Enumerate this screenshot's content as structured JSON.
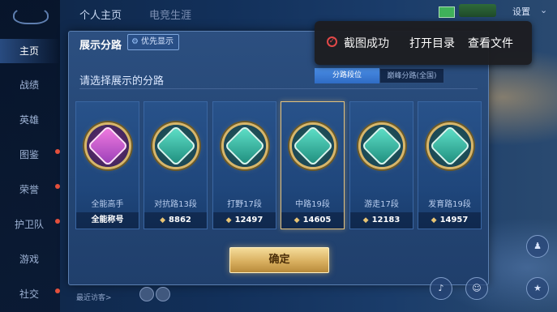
{
  "sidebar": {
    "items": [
      {
        "label": "主页",
        "active": true,
        "badge": false
      },
      {
        "label": "战绩",
        "active": false,
        "badge": false
      },
      {
        "label": "英雄",
        "active": false,
        "badge": false
      },
      {
        "label": "图鉴",
        "active": false,
        "badge": true
      },
      {
        "label": "荣誉",
        "active": false,
        "badge": true
      },
      {
        "label": "护卫队",
        "active": false,
        "badge": true
      },
      {
        "label": "游戏",
        "active": false,
        "badge": false
      },
      {
        "label": "社交",
        "active": false,
        "badge": true
      }
    ]
  },
  "header": {
    "tabs": [
      "个人主页",
      "电竞生涯"
    ],
    "settings_label": "设置"
  },
  "panel": {
    "title": "展示分路",
    "priority_label": "优先显示",
    "subtitle": "请选择展示的分路",
    "segments": [
      "分路段位",
      "巅峰分路(全国)"
    ],
    "confirm_label": "确定"
  },
  "cards": [
    {
      "name": "全能高手",
      "value": "全能称号",
      "has_gem": false,
      "selected": false,
      "badge_style": "purple",
      "glyph": "✣"
    },
    {
      "name": "对抗路13段",
      "value": "8862",
      "has_gem": true,
      "selected": false,
      "badge_style": "green",
      "glyph": "⚔"
    },
    {
      "name": "打野17段",
      "value": "12497",
      "has_gem": true,
      "selected": false,
      "badge_style": "green",
      "glyph": "❦"
    },
    {
      "name": "中路19段",
      "value": "14605",
      "has_gem": true,
      "selected": true,
      "badge_style": "green",
      "glyph": "⟋"
    },
    {
      "name": "游走17段",
      "value": "12183",
      "has_gem": true,
      "selected": false,
      "badge_style": "green",
      "glyph": "❧"
    },
    {
      "name": "发育路19段",
      "value": "14957",
      "has_gem": true,
      "selected": false,
      "badge_style": "green",
      "glyph": "◎"
    }
  ],
  "toast": {
    "message": "截图成功",
    "actions": [
      "打开目录",
      "查看文件"
    ]
  },
  "footer": {
    "visitors_label": "最近访客>"
  },
  "colors": {
    "accent_blue": "#3f7fd8",
    "gold": "#e3c27e",
    "toast_icon_red": "#e24848"
  },
  "icons": {
    "priority": "gear-icon",
    "gem": "diamond-icon",
    "toast": "check-circle-icon"
  }
}
